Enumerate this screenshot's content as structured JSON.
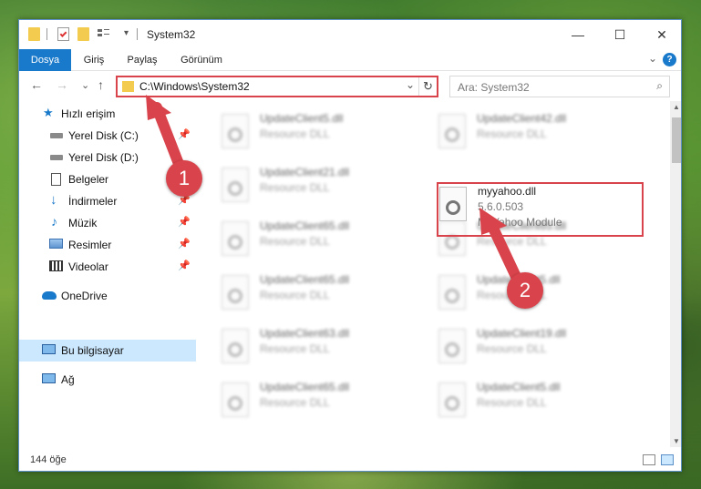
{
  "window": {
    "title": "System32",
    "minimize_glyph": "—",
    "maximize_glyph": "☐",
    "close_glyph": "✕"
  },
  "ribbon": {
    "tabs": [
      "Dosya",
      "Giriş",
      "Paylaş",
      "Görünüm"
    ],
    "help_glyph": "?",
    "collapse_glyph": "⌄"
  },
  "nav": {
    "back_glyph": "←",
    "forward_glyph": "→",
    "recent_glyph": "⌄",
    "up_glyph": "↑",
    "address_path": "C:\\Windows\\System32",
    "address_drop_glyph": "⌄",
    "refresh_glyph": "↻",
    "search_placeholder": "Ara: System32",
    "search_glyph": "⌕"
  },
  "sidebar": {
    "items": [
      {
        "label": "Hızlı erişim",
        "icon": "star-icon",
        "pinned": false
      },
      {
        "label": "Yerel Disk (C:)",
        "icon": "drive-icon",
        "pinned": true
      },
      {
        "label": "Yerel Disk (D:)",
        "icon": "drive-icon",
        "pinned": false
      },
      {
        "label": "Belgeler",
        "icon": "document-icon",
        "pinned": true
      },
      {
        "label": "İndirmeler",
        "icon": "download-icon",
        "pinned": true
      },
      {
        "label": "Müzik",
        "icon": "music-icon",
        "pinned": true
      },
      {
        "label": "Resimler",
        "icon": "picture-icon",
        "pinned": true
      },
      {
        "label": "Videolar",
        "icon": "video-icon",
        "pinned": true
      },
      {
        "label": "OneDrive",
        "icon": "cloud-icon",
        "pinned": false
      },
      {
        "label": "Bu bilgisayar",
        "icon": "computer-icon",
        "pinned": false
      },
      {
        "label": "Ağ",
        "icon": "network-icon",
        "pinned": false
      }
    ],
    "pin_glyph": "📌"
  },
  "files": {
    "left": [
      {
        "name": "UpdateClient5.dll",
        "desc": "Resource DLL"
      },
      {
        "name": "UpdateClient21.dll",
        "desc": "Resource DLL"
      },
      {
        "name": "UpdateClient65.dll",
        "desc": "Resource DLL"
      },
      {
        "name": "UpdateClient65.dll",
        "desc": "Resource DLL"
      },
      {
        "name": "UpdateClient63.dll",
        "desc": "Resource DLL"
      },
      {
        "name": "UpdateClient65.dll",
        "desc": "Resource DLL"
      }
    ],
    "right": [
      {
        "name": "UpdateClient42.dll",
        "desc": "Resource DLL"
      },
      {
        "name": "UpdateClient65.dll",
        "desc": "Resource DLL"
      },
      {
        "name": "UpdateClient5.dll",
        "desc": "Resource DLL"
      },
      {
        "name": "UpdateClient19.dll",
        "desc": "Resource DLL"
      },
      {
        "name": "UpdateClient5.dll",
        "desc": "Resource DLL"
      }
    ],
    "highlighted": {
      "name": "myyahoo.dll",
      "version": "5.6.0.503",
      "desc": "MyYahoo Module"
    }
  },
  "status": {
    "count_text": "144 öğe"
  },
  "callouts": [
    "1",
    "2"
  ],
  "colors": {
    "accent": "#1979ca",
    "highlight": "#d9434b",
    "selected": "#cce8ff"
  }
}
